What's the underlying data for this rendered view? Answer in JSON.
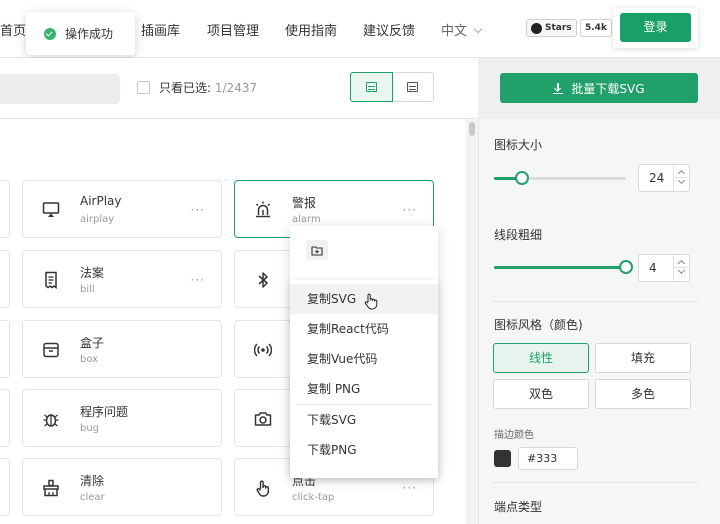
{
  "nav": {
    "home": "首页",
    "illustrations": "插画库",
    "projects": "项目管理",
    "guide": "使用指南",
    "feedback": "建议反馈",
    "language": "中文",
    "github_stars_label": "Stars",
    "github_stars_count": "5.4k",
    "login": "登录"
  },
  "toast": {
    "text": "操作成功",
    "status_color": "#36b46d"
  },
  "filter": {
    "only_selected_label": "只看已选:",
    "selected_count": "1/2437"
  },
  "icons": [
    {
      "name": "AirPlay",
      "en": "airplay",
      "icon": "airplay-icon"
    },
    {
      "name": "警报",
      "en": "alarm",
      "icon": "alarm-icon",
      "selected": true
    },
    {
      "name": "法案",
      "en": "bill",
      "icon": "bill-icon"
    },
    {
      "name": "",
      "en": "",
      "icon": "bluetooth-icon"
    },
    {
      "name": "盒子",
      "en": "box",
      "icon": "box-icon"
    },
    {
      "name": "",
      "en": "",
      "icon": "broadcast-icon"
    },
    {
      "name": "程序问题",
      "en": "bug",
      "icon": "bug-icon"
    },
    {
      "name": "",
      "en": "",
      "icon": "camera-icon"
    },
    {
      "name": "清除",
      "en": "clear",
      "icon": "clear-icon"
    },
    {
      "name": "点击",
      "en": "click-tap",
      "icon": "click-tap-icon"
    }
  ],
  "more_label": "···",
  "context_menu": {
    "items": [
      "复制SVG",
      "复制React代码",
      "复制Vue代码",
      "复制 PNG",
      "下载SVG",
      "下载PNG"
    ]
  },
  "panel": {
    "bulk_download": "批量下载SVG",
    "icon_size_label": "图标大小",
    "icon_size_value": "24",
    "icon_size_fraction": 0.21,
    "stroke_width_label": "线段粗细",
    "stroke_width_value": "4",
    "stroke_width_fraction": 1.0,
    "style_label": "图标风格（颜色)",
    "styles": [
      "线性",
      "填充",
      "双色",
      "多色"
    ],
    "active_style": "线性",
    "stroke_color_label": "描边颜色",
    "stroke_color_value": "#333",
    "endpoint_label": "端点类型"
  },
  "colors": {
    "brand": "#18a067",
    "accent": "#22a06b"
  }
}
